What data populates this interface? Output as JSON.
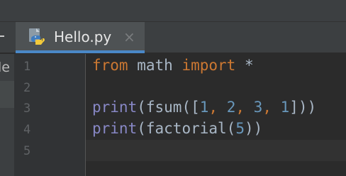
{
  "tab": {
    "filename": "Hello.py",
    "close_glyph": "×",
    "icon": "python-file-icon"
  },
  "project_panel": {
    "partial_text": "le"
  },
  "gutter": {
    "line_numbers": [
      "1",
      "2",
      "3",
      "4",
      "5"
    ]
  },
  "code": {
    "line1": {
      "kw_from": "from",
      "module": " math ",
      "kw_import": "import",
      "star": " *"
    },
    "line3": {
      "fn_print": "print",
      "p1": "(",
      "fn_fsum": "fsum",
      "p2": "([",
      "n1": "1",
      "c1": ", ",
      "n2": "2",
      "c2": ", ",
      "n3": "3",
      "c3": ", ",
      "n4": "1",
      "p3": "]))"
    },
    "line4": {
      "fn_print": "print",
      "p1": "(",
      "fn_factorial": "factorial",
      "p2": "(",
      "n1": "5",
      "p3": "))"
    }
  },
  "colors": {
    "keyword": "#cc7832",
    "builtin": "#8888c6",
    "number": "#6897bb",
    "text": "#a9b7c6",
    "tab_accent": "#4a88c7"
  }
}
